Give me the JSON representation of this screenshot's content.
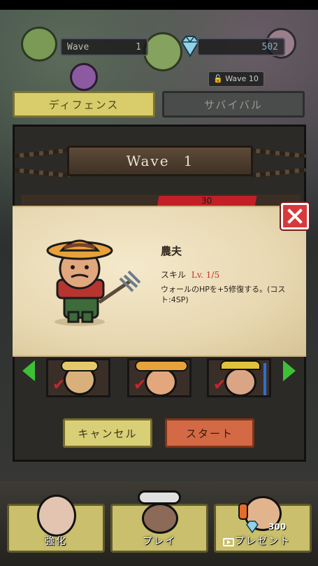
{
  "hud": {
    "wave_label": "Wave",
    "wave_value": "1",
    "gems": "502",
    "lock_label": "Wave 10"
  },
  "tabs": [
    {
      "label": "ディフェンス",
      "active": true
    },
    {
      "label": "サバイバル",
      "active": false
    }
  ],
  "board": {
    "wave_sign_label": "Wave",
    "wave_sign_value": "1",
    "goal_partial": "30"
  },
  "dialog": {
    "character_name": "農夫",
    "skill_label": "スキル",
    "skill_level": "Lv. 1/5",
    "description": "ウォールのHPを+5修復する。(コスト:4SP)",
    "close_icon": "close-x-icon"
  },
  "party": [
    {
      "character": "blonde-survivor",
      "selected": true
    },
    {
      "character": "farmer",
      "selected": true
    },
    {
      "character": "helmet-worker",
      "selected": true
    }
  ],
  "actions": {
    "cancel": "キャンセル",
    "start": "スタート"
  },
  "nav": [
    {
      "label": "強化"
    },
    {
      "label": "プレイ"
    },
    {
      "label": "プレゼント",
      "badge": "300"
    }
  ],
  "colors": {
    "accent_yellow": "#d8cd6a",
    "start_orange": "#d36a45",
    "close_red": "#d63a3c",
    "skill_level_red": "#c0352c"
  }
}
